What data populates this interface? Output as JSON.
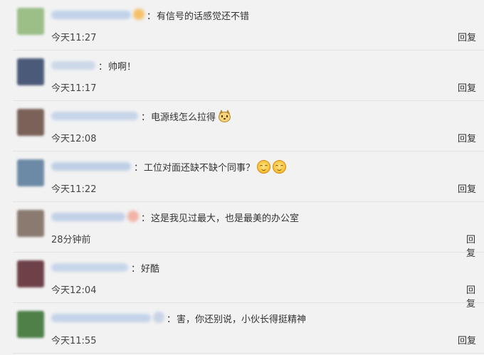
{
  "reply_label": "回复",
  "comments": [
    {
      "avatar_color": "#9bbf86",
      "name_color": "#b9cde8",
      "name_width": 112,
      "has_name_icon": true,
      "name_icon_color": "#f5c06a",
      "text": "有信号的话感觉还不错",
      "emoji": [],
      "time": "今天11:27"
    },
    {
      "avatar_color": "#4a5a78",
      "name_color": "#c6d3e6",
      "name_width": 62,
      "has_name_icon": false,
      "text": "帅啊！",
      "emoji": [],
      "time": "今天11:17"
    },
    {
      "avatar_color": "#7a6258",
      "name_color": "#bfd0e8",
      "name_width": 122,
      "has_name_icon": false,
      "text": "电源线怎么拉得",
      "emoji": [
        "cat-face"
      ],
      "time": "今天12:08"
    },
    {
      "avatar_color": "#6c8aa6",
      "name_color": "#b5c9e4",
      "name_width": 112,
      "has_name_icon": false,
      "text": "工位对面还缺不缺个同事？",
      "emoji": [
        "smile",
        "smile"
      ],
      "time": "今天11:22"
    },
    {
      "avatar_color": "#8a7a70",
      "name_color": "#b9cbe6",
      "name_width": 104,
      "has_name_icon": true,
      "name_icon_color": "#f2b2a6",
      "text": "这是我见过最大，也是最美的办公室",
      "emoji": [],
      "time": "28分钟前"
    },
    {
      "avatar_color": "#6e4048",
      "name_color": "#c0d1ea",
      "name_width": 108,
      "has_name_icon": false,
      "text": "好酷",
      "emoji": [],
      "time": "今天12:04"
    },
    {
      "avatar_color": "#4e8048",
      "name_color": "#bccee8",
      "name_width": 140,
      "has_name_icon": true,
      "name_icon_color": "#c9d4e6",
      "text": "害，你还别说，小伙长得挺精神",
      "emoji": [],
      "time": "今天11:55"
    }
  ]
}
